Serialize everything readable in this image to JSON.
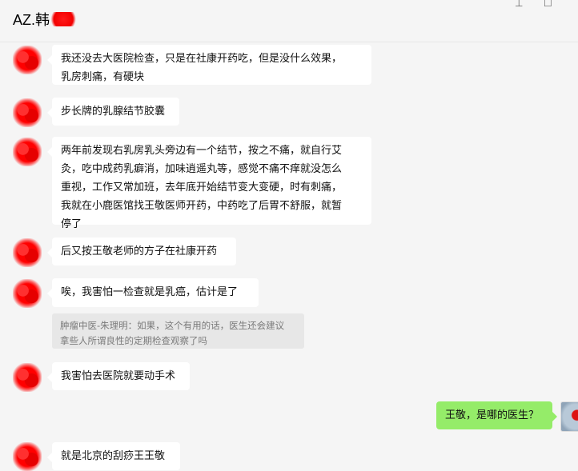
{
  "header": {
    "title": "AZ.韩",
    "pin_icon": "pin-icon",
    "maximize_icon": "maximize-icon"
  },
  "messages": [
    {
      "side": "left",
      "text": "我还没去大医院检查，只是在社康开药吃，但是没什么效果，\n乳房刺痛，有硬块"
    },
    {
      "side": "left",
      "text": "步长牌的乳腺结节胶囊"
    },
    {
      "side": "left",
      "text": "两年前发现右乳房乳头旁边有一个结节，按之不痛，就自行艾\n灸，吃中成药乳癖消，加味逍遥丸等，感觉不痛不痒就没怎么\n重视，工作又常加班，去年底开始结节变大变硬，时有刺痛，\n我就在小鹿医馆找王敬医师开药，中药吃了后胃不舒服，就暂\n停了"
    },
    {
      "side": "left",
      "text": "后又按王敬老师的方子在社康开药"
    },
    {
      "side": "left",
      "text": "唉，我害怕一检查就是乳癌，估计是了",
      "quote": "肿瘤中医-朱理明：如果，这个有用的话，医生还会建议\n拿些人所谓良性的定期检查观察了吗"
    },
    {
      "side": "left",
      "text": "我害怕去医院就要动手术"
    },
    {
      "side": "right",
      "text": "王敬，是哪的医生？"
    },
    {
      "side": "left",
      "text": "就是北京的刮痧王王敬"
    }
  ],
  "colors": {
    "background": "#f5f5f5",
    "bubble_left": "#ffffff",
    "bubble_right": "#95ec69",
    "quote_bg": "#e7e7e7"
  }
}
